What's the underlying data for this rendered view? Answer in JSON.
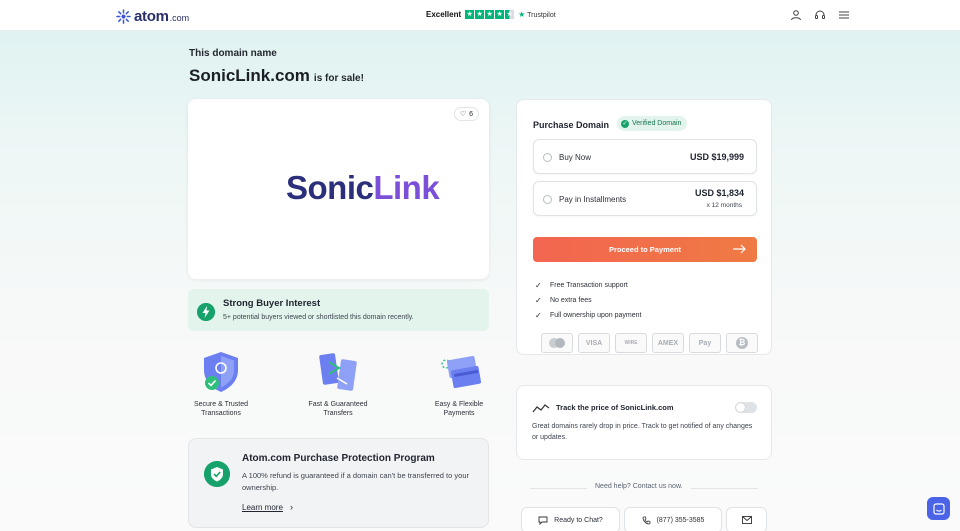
{
  "header": {
    "logo_text": "atom",
    "logo_suffix": ".com",
    "rating_label": "Excellent",
    "rating_stars": 4.5,
    "trustpilot_label": "Trustpilot",
    "icons": [
      "user-icon",
      "headset-icon",
      "menu-icon"
    ]
  },
  "page": {
    "subheading": "This domain name",
    "domain": "SonicLink.com",
    "suffix": "is for sale!"
  },
  "logo_card": {
    "likes": "6",
    "brand_part1": "Sonic",
    "brand_part2": "Link"
  },
  "interest": {
    "title": "Strong Buyer Interest",
    "text": "5+ potential buyers viewed or shortlisted this domain recently."
  },
  "features": [
    {
      "label": "Secure & Trusted\nTransactions",
      "icon": "secure-shield-icon"
    },
    {
      "label": "Fast & Guaranteed\nTransfers",
      "icon": "transfer-icon"
    },
    {
      "label": "Easy & Flexible\nPayments",
      "icon": "payment-cards-icon"
    }
  ],
  "protection": {
    "title": "Atom.com Purchase Protection Program",
    "text": "A 100% refund is guaranteed if a domain can't be transferred to your ownership.",
    "link": "Learn more"
  },
  "purchase": {
    "title": "Purchase Domain",
    "verified": "Verified Domain",
    "options": [
      {
        "label": "Buy Now",
        "price": "USD $19,999",
        "sub": ""
      },
      {
        "label": "Pay in Installments",
        "price": "USD $1,834",
        "sub": "x 12 months"
      }
    ],
    "cta": "Proceed to Payment",
    "benefits": [
      "Free Transaction support",
      "No extra fees",
      "Full ownership upon payment"
    ],
    "payment_methods": [
      "Mastercard",
      "VISA",
      "Wire Transfer",
      "AMEX",
      "Apple Pay",
      "Bitcoin"
    ],
    "payment_labels": [
      "",
      "VISA",
      "WIRE",
      "AMEX",
      "Pay",
      "₿"
    ]
  },
  "track": {
    "title": "Track the price of SonicLink.com",
    "text": "Great domains rarely drop in price. Track to get notified of any changes or updates."
  },
  "help": {
    "label": "Need help? Contact us now.",
    "chat": "Ready to Chat?",
    "phone": "(877) 355-3585"
  },
  "colors": {
    "accent": "#16a26a",
    "cta_start": "#f36550",
    "cta_end": "#ef7a44",
    "brand_dark": "#2c2f7c",
    "brand_purple": "#7b4fd8"
  }
}
